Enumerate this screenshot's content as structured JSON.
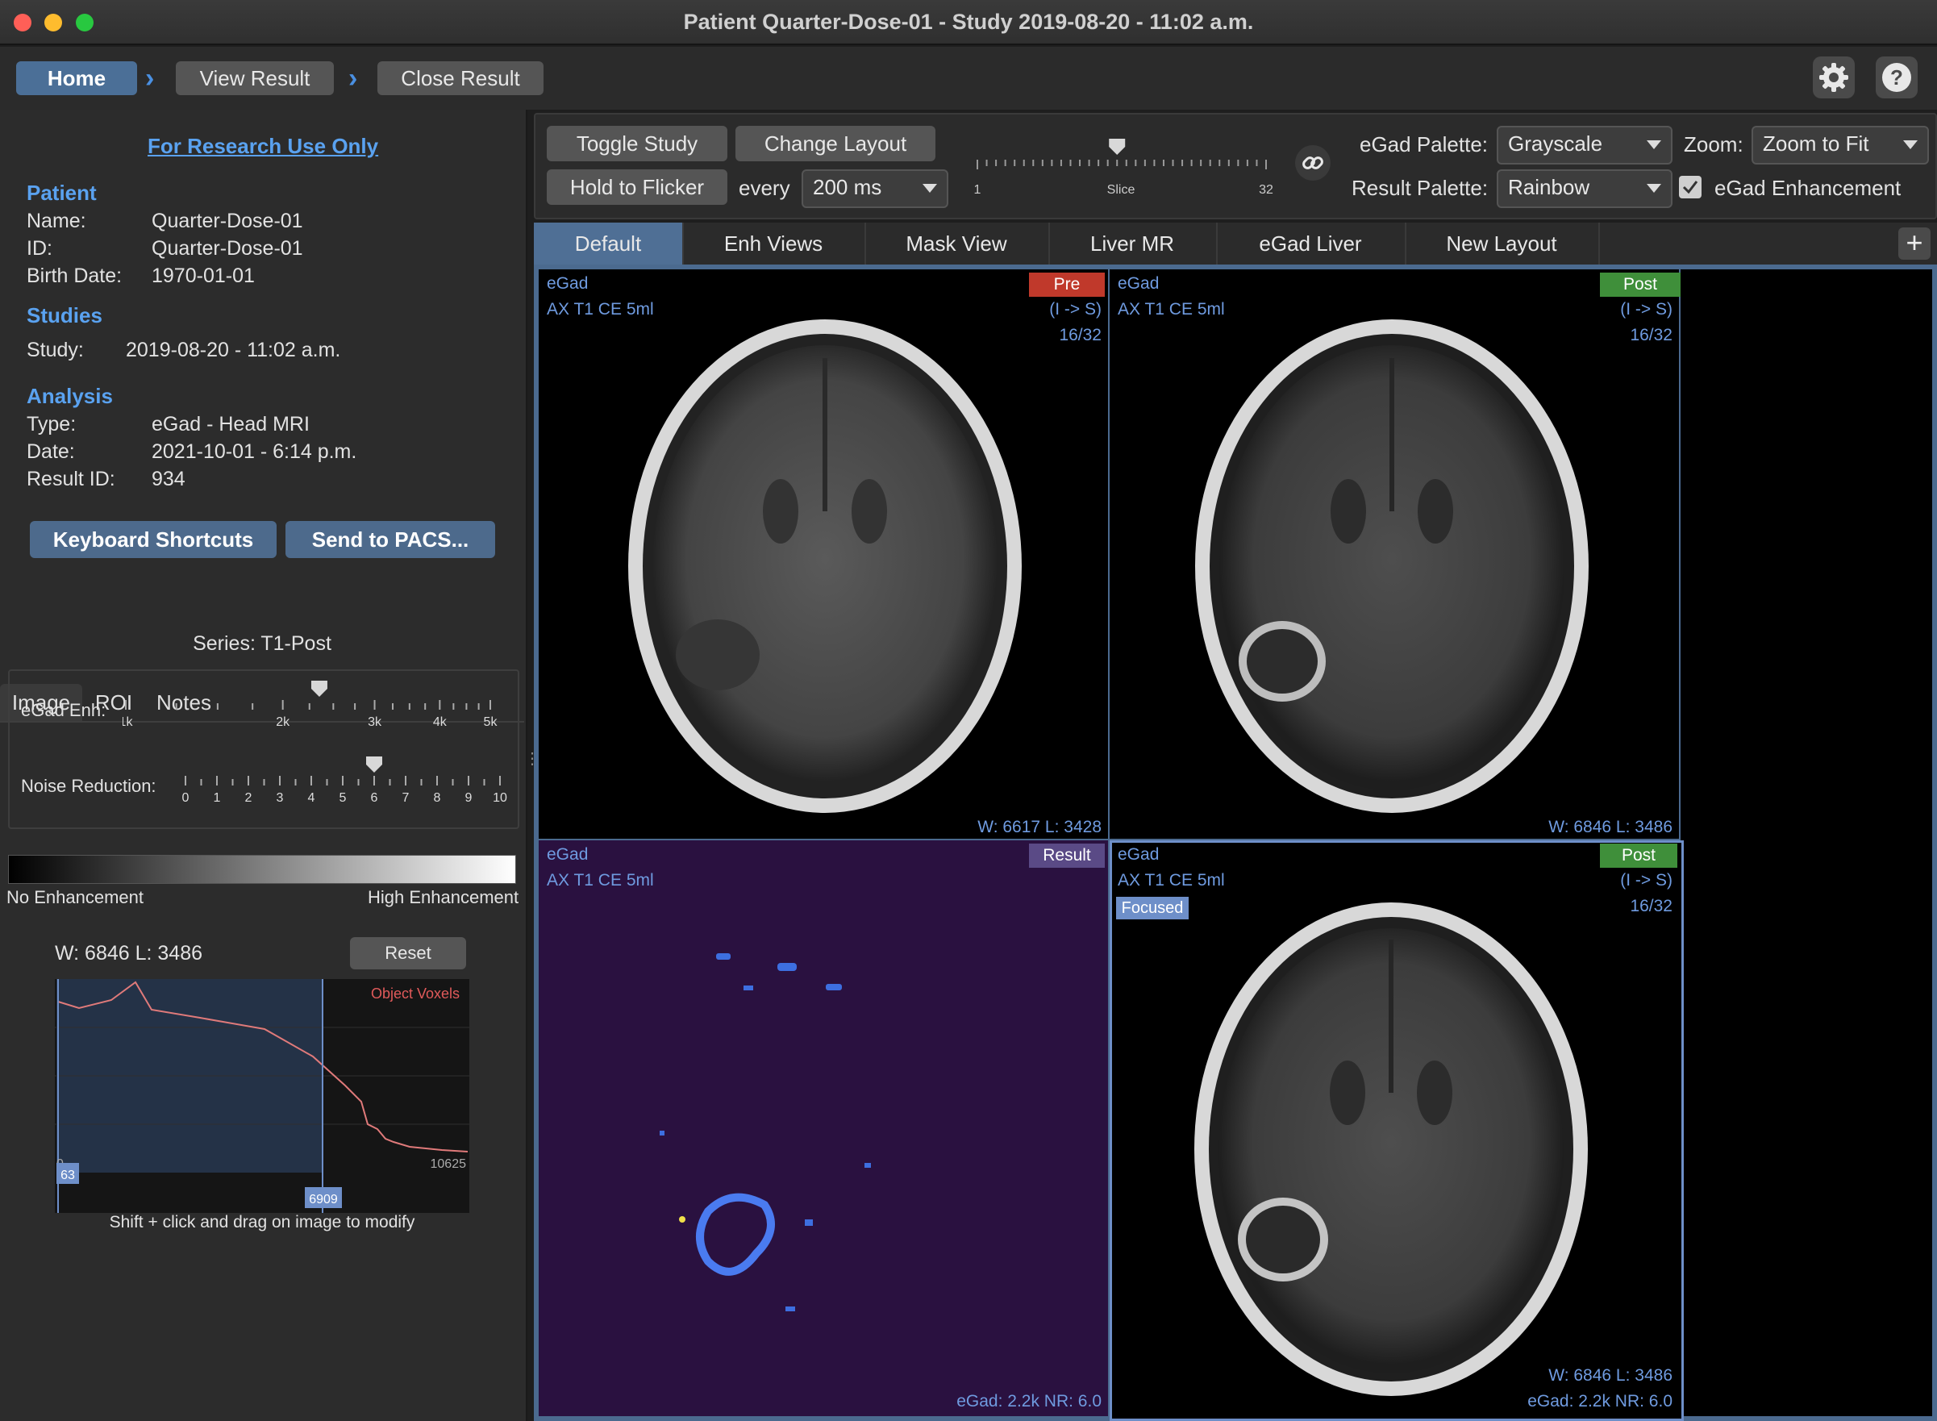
{
  "window": {
    "title": "Patient Quarter-Dose-01 - Study 2019-08-20 - 11:02 a.m."
  },
  "nav": {
    "home": "Home",
    "view_result": "View Result",
    "close_result": "Close Result"
  },
  "icons": {
    "settings": "gear-icon",
    "help": "question-icon",
    "link": "link-icon",
    "add": "plus-icon"
  },
  "left": {
    "research_notice": "For Research Use Only",
    "patient": {
      "heading": "Patient",
      "name_label": "Name:",
      "name": "Quarter-Dose-01",
      "id_label": "ID:",
      "id": "Quarter-Dose-01",
      "birth_label": "Birth Date:",
      "birth": "1970-01-01"
    },
    "studies": {
      "heading": "Studies",
      "study_label": "Study:",
      "study": "2019-08-20 - 11:02 a.m."
    },
    "analysis": {
      "heading": "Analysis",
      "type_label": "Type:",
      "type": "eGad - Head MRI",
      "date_label": "Date:",
      "date": "2021-10-01 - 6:14 p.m.",
      "result_label": "Result ID:",
      "result": "934"
    },
    "buttons": {
      "shortcuts": "Keyboard Shortcuts",
      "pacs": "Send to PACS..."
    },
    "tabs": [
      "Image",
      "ROI",
      "Notes"
    ],
    "series": "Series:  T1-Post",
    "egad_enh": {
      "label": "eGad Enh:",
      "ticks": [
        "1k",
        "2k",
        "3k",
        "4k",
        "5k"
      ],
      "value": 2350
    },
    "noise": {
      "label": "Noise Reduction:",
      "ticks": [
        "0",
        "1",
        "2",
        "3",
        "4",
        "5",
        "6",
        "7",
        "8",
        "9",
        "10"
      ],
      "value": 6
    },
    "gradient": {
      "low": "No Enhancement",
      "high": "High Enhancement"
    },
    "wl": "W: 6846 L: 3486",
    "reset": "Reset",
    "histogram": {
      "legend": "Object Voxels",
      "min": "0",
      "max": "10625",
      "low_marker": "63",
      "high_marker": "6909"
    },
    "hint": "Shift + click and drag on image to modify"
  },
  "controls": {
    "toggle_study": "Toggle Study",
    "change_layout": "Change Layout",
    "hold_to_flicker": "Hold to Flicker",
    "every": "every",
    "interval": "200 ms",
    "slice": {
      "min": "1",
      "label": "Slice",
      "max": "32",
      "value": 16
    },
    "egad_palette_label": "eGad Palette:",
    "egad_palette": "Grayscale",
    "result_palette_label": "Result Palette:",
    "result_palette": "Rainbow",
    "zoom_label": "Zoom:",
    "zoom": "Zoom to Fit",
    "enhancement_label": "eGad Enhancement",
    "enhancement_checked": true
  },
  "layout_tabs": [
    "Default",
    "Enh Views",
    "Mask View",
    "Liver MR",
    "eGad Liver",
    "New Layout"
  ],
  "viewports": [
    {
      "app": "eGad",
      "series": "AX T1 CE 5ml",
      "tag": "Pre",
      "orient": "(I -> S)",
      "slice": "16/32",
      "footer": "W: 6617 L: 3428"
    },
    {
      "app": "eGad",
      "series": "AX T1 CE 5ml",
      "tag": "Post",
      "orient": "(I -> S)",
      "slice": "16/32",
      "footer": "W: 6846 L: 3486"
    },
    {
      "app": "eGad",
      "series": "AX T1 CE 5ml",
      "tag": "Result",
      "footer": "eGad: 2.2k NR: 6.0"
    },
    {
      "app": "eGad",
      "series": "AX T1 CE 5ml",
      "tag": "Post",
      "orient": "(I -> S)",
      "slice": "16/32",
      "status": "Focused",
      "footer": "W: 6846 L: 3486",
      "footer2": "eGad: 2.2k NR: 6.0"
    }
  ],
  "colors": {
    "pre_tag": "#c0392b",
    "post_tag": "#3f8f3a",
    "result_tag": "#5a4a86",
    "accent": "#4a90e2"
  }
}
